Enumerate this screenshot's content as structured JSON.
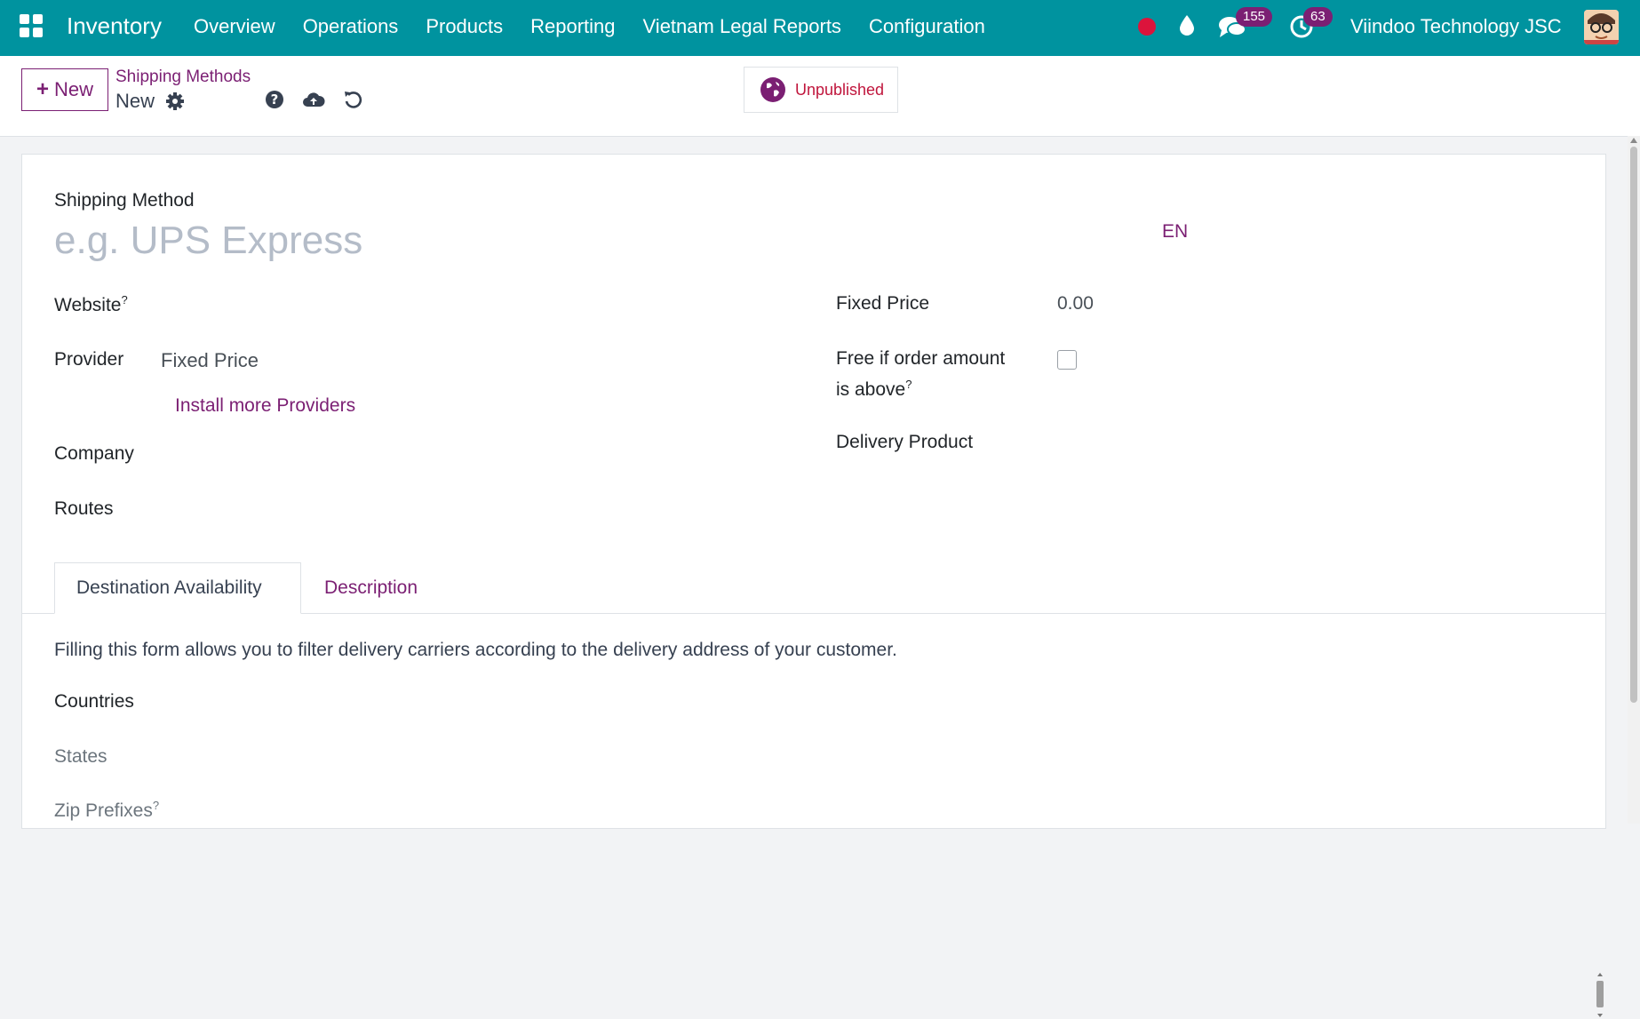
{
  "navbar": {
    "brand": "Inventory",
    "menu": [
      "Overview",
      "Operations",
      "Products",
      "Reporting",
      "Vietnam Legal Reports",
      "Configuration"
    ],
    "messages_count": "155",
    "activities_count": "63",
    "company": "Viindoo Technology JSC"
  },
  "control": {
    "new_label": "New",
    "breadcrumb_parent": "Shipping Methods",
    "breadcrumb_current": "New",
    "publish_label": "Unpublished"
  },
  "form": {
    "name_label": "Shipping Method",
    "name_placeholder": "e.g. UPS Express",
    "lang": "EN",
    "website_label": "Website",
    "provider_label": "Provider",
    "provider_value": "Fixed Price",
    "install_providers": "Install more Providers",
    "company_label": "Company",
    "routes_label": "Routes",
    "fixed_price_label": "Fixed Price",
    "fixed_price_value": "0.00",
    "free_if_label_1": "Free if order amount",
    "free_if_label_2": "is above",
    "delivery_product_label": "Delivery Product",
    "help_mark": "?"
  },
  "tabs": [
    "Destination Availability",
    "Description"
  ],
  "destination": {
    "info": "Filling this form allows you to filter delivery carriers according to the delivery address of your customer.",
    "countries_label": "Countries",
    "states_label": "States",
    "zip_label": "Zip Prefixes"
  },
  "colors": {
    "navbar": "#00939f",
    "accent": "#7b1f73",
    "unpublished": "#c0153c"
  }
}
